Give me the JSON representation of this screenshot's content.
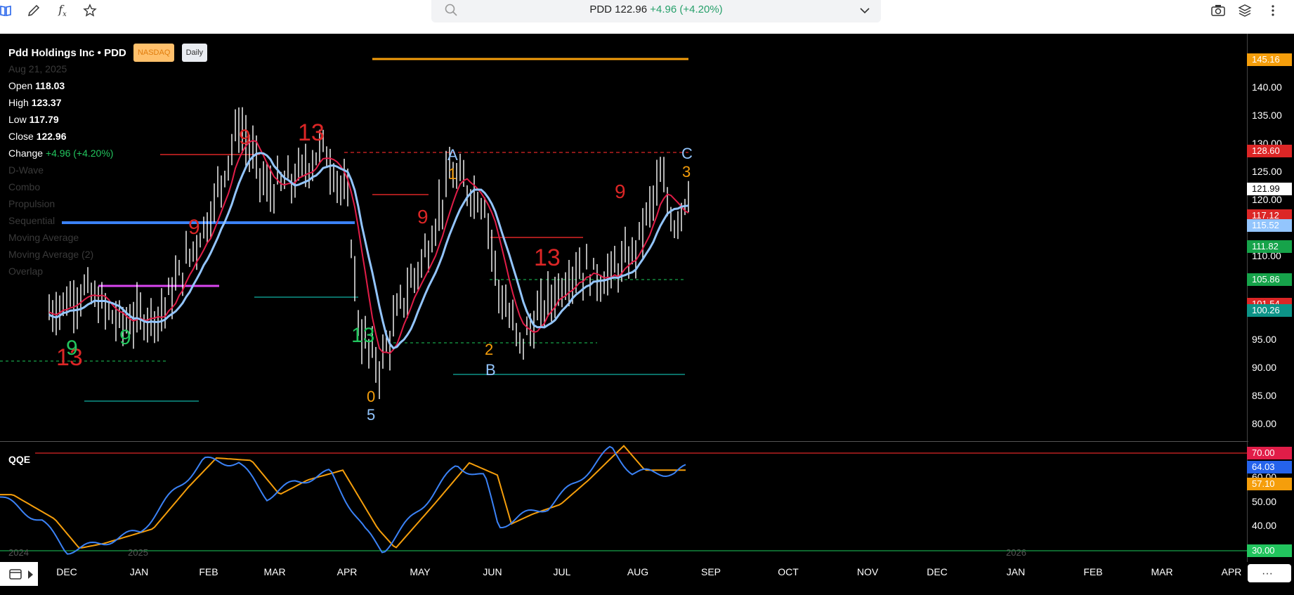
{
  "toolbar": {
    "symbol": "PDD",
    "price": "122.96",
    "change": "+4.96",
    "change_pct": "(+4.20%)"
  },
  "info": {
    "name": "Pdd Holdings Inc • PDD",
    "exchange": "NASDAQ",
    "interval": "Daily",
    "date": "Aug 21, 2025",
    "open_label": "Open",
    "open": "118.03",
    "high_label": "High",
    "high": "123.37",
    "low_label": "Low",
    "low": "117.79",
    "close_label": "Close",
    "close": "122.96",
    "change_label": "Change",
    "change": "+4.96 (+4.20%)",
    "indicators": [
      "D-Wave",
      "Combo",
      "Propulsion",
      "Sequential",
      "Moving Average",
      "Moving Average (2)",
      "Overlap"
    ]
  },
  "qqe": {
    "label": "QQE",
    "ticks": [
      "70.00",
      "60.00",
      "50.00",
      "40.00",
      "30.00"
    ],
    "tags": [
      {
        "value": "70.00",
        "color": "#e11d48"
      },
      {
        "value": "64.03",
        "color": "#2563eb"
      },
      {
        "value": "57.10",
        "color": "#f59e0b"
      },
      {
        "value": "30.00",
        "color": "#22c55e"
      }
    ]
  },
  "price_axis": {
    "ticks": [
      "140.00",
      "135.00",
      "130.00",
      "125.00",
      "120.00",
      "110.00",
      "95.00",
      "90.00",
      "85.00",
      "80.00"
    ],
    "tags": [
      {
        "value": "145.16",
        "color": "#f59e0b"
      },
      {
        "value": "128.60",
        "color": "#dc2626"
      },
      {
        "value": "121.99",
        "color": "#ffffff"
      },
      {
        "value": "117.12",
        "color": "#dc2626"
      },
      {
        "value": "115.52",
        "color": "#93c5fd"
      },
      {
        "value": "111.82",
        "color": "#16a34a"
      },
      {
        "value": "105.86",
        "color": "#16a34a"
      },
      {
        "value": "101.54",
        "color": "#dc2626"
      },
      {
        "value": "100.26",
        "color": "#0d9488"
      }
    ]
  },
  "time_axis": {
    "months": [
      "DEC",
      "JAN",
      "FEB",
      "MAR",
      "APR",
      "MAY",
      "JUN",
      "JUL",
      "AUG",
      "SEP",
      "OCT",
      "NOV",
      "DEC",
      "JAN",
      "FEB",
      "MAR",
      "APR"
    ],
    "years": [
      "2024",
      "2025",
      "2026"
    ]
  },
  "annotations": {
    "wave": [
      "A",
      "B",
      "C",
      "0",
      "5",
      "1",
      "2",
      "3"
    ],
    "counts": [
      "9",
      "13",
      "9",
      "13",
      "9",
      "9",
      "13",
      "9",
      "9",
      "13"
    ]
  }
}
